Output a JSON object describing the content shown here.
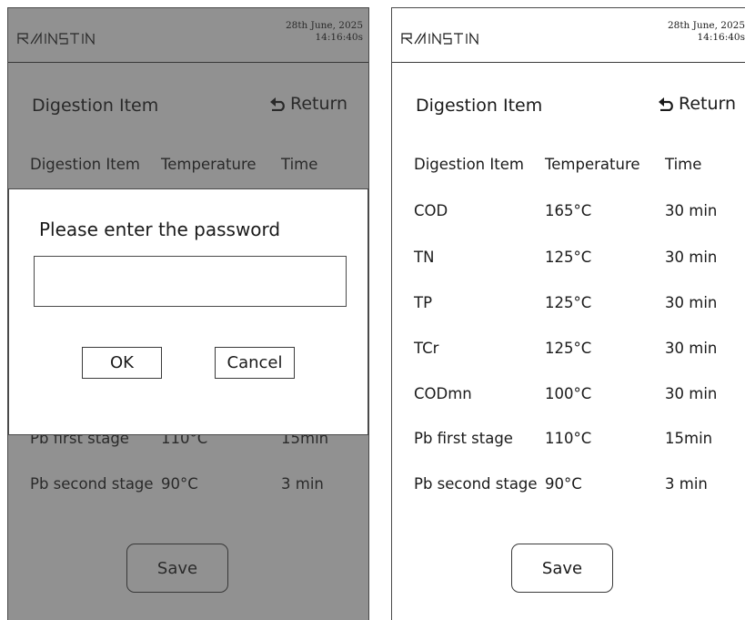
{
  "header": {
    "brand": "RAINSTIN",
    "date": "28th June, 2025",
    "time": "14:16:40s"
  },
  "page_title": "Digestion Item",
  "return_label": "Return",
  "table": {
    "columns": [
      "Digestion Item",
      "Temperature",
      "Time"
    ],
    "rows": [
      [
        "COD",
        "165°C",
        "30 min"
      ],
      [
        "TN",
        "125°C",
        "30 min"
      ],
      [
        "TP",
        "125°C",
        "30 min"
      ],
      [
        "TCr",
        "125°C",
        "30 min"
      ],
      [
        "CODmn",
        "100°C",
        "30 min"
      ],
      [
        "Pb first stage",
        "110°C",
        "15min"
      ],
      [
        "Pb second stage",
        "90°C",
        "3 min"
      ]
    ]
  },
  "save_label": "Save",
  "dialog": {
    "title": "Please enter the password",
    "password_value": "",
    "ok_label": "OK",
    "cancel_label": "Cancel"
  },
  "colors": {
    "overlay": "#5a5a5a",
    "border": "#3a3a3a",
    "background": "#ffffff"
  }
}
